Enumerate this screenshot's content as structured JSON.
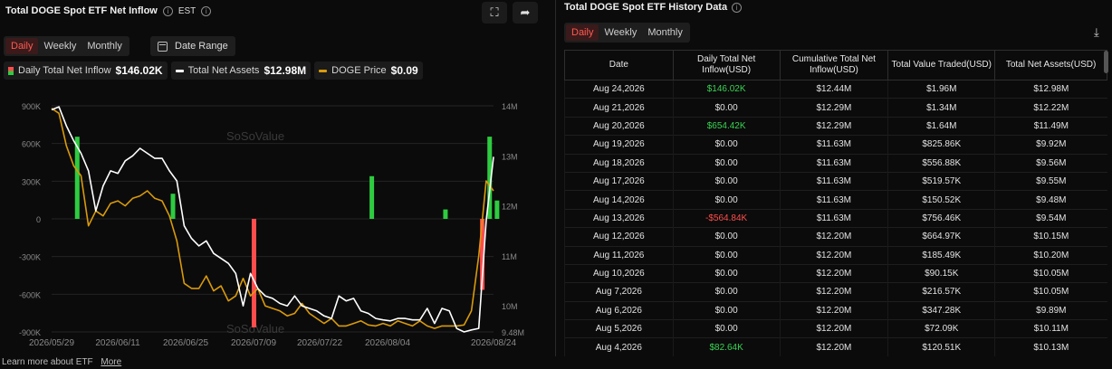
{
  "left": {
    "title": "Total DOGE Spot ETF Net Inflow",
    "timezone": "EST",
    "tabs": [
      "Daily",
      "Weekly",
      "Monthly"
    ],
    "active_tab": "Daily",
    "date_range_label": "Date Range",
    "legend": [
      {
        "label": "Daily Total Net Inflow",
        "value": "$146.02K"
      },
      {
        "label": "Total Net Assets",
        "value": "$12.98M"
      },
      {
        "label": "DOGE Price",
        "value": "$0.09"
      }
    ],
    "watermark": "SoSoValue"
  },
  "chart_data": {
    "type": "bar",
    "colors": {
      "positive": "#2ecc40",
      "negative": "#ff4d4d",
      "assets": "#ffffff",
      "price": "#d99a0b",
      "grid": "#242424"
    },
    "y_left_ticks": [
      "900K",
      "600K",
      "300K",
      "0",
      "-300K",
      "-600K",
      "-900K"
    ],
    "y_left_range": [
      -900000,
      900000
    ],
    "y_right_ticks": [
      "14M",
      "13M",
      "12M",
      "11M",
      "10M",
      "9.48M"
    ],
    "y_right_range": [
      9.48,
      14.0
    ],
    "x_tick_labels": [
      "2026/05/29",
      "2026/06/11",
      "2026/06/25",
      "2026/07/09",
      "2026/07/22",
      "2026/08/04",
      "2026/08/24"
    ],
    "n_points": 60,
    "inflow_bars": [
      {
        "index": 2,
        "value": 654000
      },
      {
        "index": 15,
        "value": 200000
      },
      {
        "index": 26,
        "value": -864000
      },
      {
        "index": 42,
        "value": 340000
      },
      {
        "index": 52,
        "value": 75000
      },
      {
        "index": 57,
        "value": -564840
      },
      {
        "index": 58,
        "value": 654420
      },
      {
        "index": 59,
        "value": 146020
      }
    ],
    "total_net_assets_M": [
      13.92,
      13.98,
      13.6,
      13.3,
      13.05,
      12.7,
      11.9,
      12.4,
      12.7,
      12.65,
      12.9,
      13.0,
      13.15,
      13.05,
      12.95,
      12.95,
      12.7,
      12.5,
      11.6,
      11.35,
      11.2,
      11.3,
      11.05,
      10.95,
      10.85,
      10.65,
      10.0,
      10.65,
      10.35,
      10.2,
      10.15,
      10.05,
      10.0,
      10.2,
      10.0,
      9.95,
      9.9,
      9.8,
      9.75,
      10.2,
      10.1,
      10.15,
      9.9,
      9.85,
      9.75,
      9.72,
      9.7,
      9.75,
      9.75,
      9.72,
      9.72,
      9.95,
      9.65,
      9.95,
      9.9,
      9.55,
      9.48,
      9.52,
      9.55,
      11.7,
      12.98
    ],
    "price_M": [
      13.95,
      13.85,
      13.2,
      12.8,
      12.6,
      11.6,
      11.9,
      11.8,
      12.05,
      12.1,
      12.0,
      12.15,
      12.2,
      12.3,
      12.15,
      12.1,
      11.8,
      11.3,
      10.45,
      10.35,
      10.35,
      10.6,
      10.3,
      10.4,
      10.1,
      10.2,
      10.55,
      10.2,
      10.35,
      10.0,
      9.95,
      9.9,
      9.8,
      9.85,
      10.05,
      9.85,
      9.75,
      9.65,
      9.75,
      9.6,
      9.6,
      9.65,
      9.7,
      9.62,
      9.6,
      9.65,
      9.6,
      9.7,
      9.65,
      9.6,
      9.7,
      9.6,
      9.55,
      9.6,
      9.6,
      9.6,
      9.62,
      9.9,
      11.0,
      12.5,
      12.3
    ]
  },
  "right": {
    "title": "Total DOGE Spot ETF History Data",
    "tabs": [
      "Daily",
      "Weekly",
      "Monthly"
    ],
    "active_tab": "Daily",
    "columns": [
      "Date",
      "Daily Total Net Inflow(USD)",
      "Cumulative Total Net Inflow(USD)",
      "Total Value Traded(USD)",
      "Total Net Assets(USD)"
    ],
    "rows": [
      {
        "date": "Aug 24,2026",
        "inflow": "$146.02K",
        "cum": "$12.44M",
        "traded": "$1.96M",
        "assets": "$12.98M",
        "sign": "pos"
      },
      {
        "date": "Aug 21,2026",
        "inflow": "$0.00",
        "cum": "$12.29M",
        "traded": "$1.34M",
        "assets": "$12.22M",
        "sign": ""
      },
      {
        "date": "Aug 20,2026",
        "inflow": "$654.42K",
        "cum": "$12.29M",
        "traded": "$1.64M",
        "assets": "$11.49M",
        "sign": "pos"
      },
      {
        "date": "Aug 19,2026",
        "inflow": "$0.00",
        "cum": "$11.63M",
        "traded": "$825.86K",
        "assets": "$9.92M",
        "sign": ""
      },
      {
        "date": "Aug 18,2026",
        "inflow": "$0.00",
        "cum": "$11.63M",
        "traded": "$556.88K",
        "assets": "$9.56M",
        "sign": ""
      },
      {
        "date": "Aug 17,2026",
        "inflow": "$0.00",
        "cum": "$11.63M",
        "traded": "$519.57K",
        "assets": "$9.55M",
        "sign": ""
      },
      {
        "date": "Aug 14,2026",
        "inflow": "$0.00",
        "cum": "$11.63M",
        "traded": "$150.52K",
        "assets": "$9.48M",
        "sign": ""
      },
      {
        "date": "Aug 13,2026",
        "inflow": "-$564.84K",
        "cum": "$11.63M",
        "traded": "$756.46K",
        "assets": "$9.54M",
        "sign": "neg"
      },
      {
        "date": "Aug 12,2026",
        "inflow": "$0.00",
        "cum": "$12.20M",
        "traded": "$664.97K",
        "assets": "$10.15M",
        "sign": ""
      },
      {
        "date": "Aug 11,2026",
        "inflow": "$0.00",
        "cum": "$12.20M",
        "traded": "$185.49K",
        "assets": "$10.20M",
        "sign": ""
      },
      {
        "date": "Aug 10,2026",
        "inflow": "$0.00",
        "cum": "$12.20M",
        "traded": "$90.15K",
        "assets": "$10.05M",
        "sign": ""
      },
      {
        "date": "Aug 7,2026",
        "inflow": "$0.00",
        "cum": "$12.20M",
        "traded": "$216.57K",
        "assets": "$10.05M",
        "sign": ""
      },
      {
        "date": "Aug 6,2026",
        "inflow": "$0.00",
        "cum": "$12.20M",
        "traded": "$347.28K",
        "assets": "$9.89M",
        "sign": ""
      },
      {
        "date": "Aug 5,2026",
        "inflow": "$0.00",
        "cum": "$12.20M",
        "traded": "$72.09K",
        "assets": "$10.11M",
        "sign": ""
      },
      {
        "date": "Aug 4,2026",
        "inflow": "$82.64K",
        "cum": "$12.20M",
        "traded": "$120.51K",
        "assets": "$10.13M",
        "sign": "pos"
      }
    ]
  },
  "footer": {
    "text": "Learn more about ETF",
    "more": "More"
  }
}
